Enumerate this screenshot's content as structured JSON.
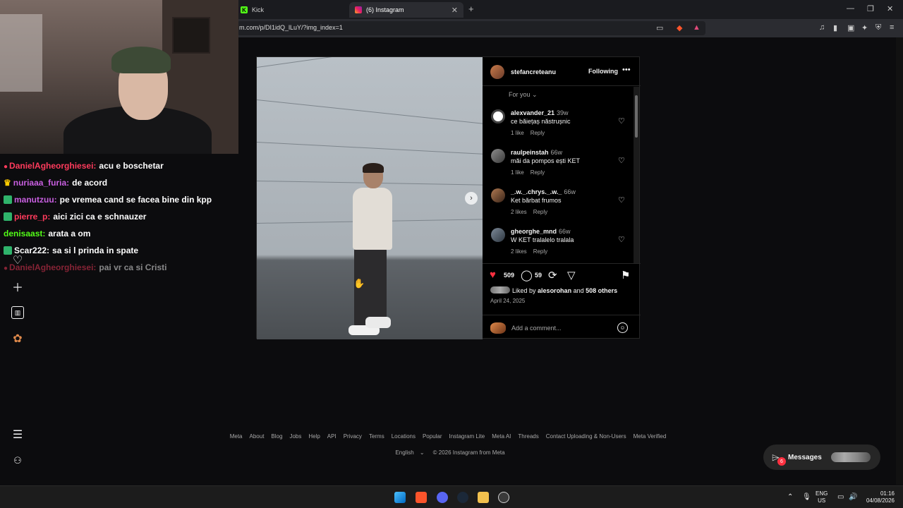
{
  "browser": {
    "tabs": [
      {
        "label": "Kick",
        "icon": "kick-icon"
      },
      {
        "label": "(6) Instagram",
        "icon": "instagram-icon"
      }
    ],
    "url": "m.com/p/DI1idQ_lLuY/?img_index=1"
  },
  "chat": [
    {
      "user": "DanielAgheorghiesei:",
      "msg": "acu e boschetar",
      "color": "#ff3b5c",
      "badge": "dot"
    },
    {
      "user": "nuriaaa_furia:",
      "msg": "de acord",
      "color": "#c85fe0",
      "badge": "crown"
    },
    {
      "user": "manutzuu:",
      "msg": "pe vremea cand se facea bine din kpp",
      "color": "#c85fe0",
      "badge": "sub"
    },
    {
      "user": "pierre_p:",
      "msg": "aici zici ca e schnauzer",
      "color": "#ff3b5c",
      "badge": "sub"
    },
    {
      "user": "denisaast:",
      "msg": "arata a om",
      "color": "#53fc18",
      "badge": "none"
    },
    {
      "user": "Scar222:",
      "msg": "sa si l prinda in spate",
      "color": "#ffffff",
      "badge": "sub"
    },
    {
      "user": "DanielAgheorghiesei:",
      "msg": "pai vr ca si Cristi",
      "color": "#ff3b5c",
      "badge": "dot",
      "faded": true
    }
  ],
  "post": {
    "username": "stefancreteanu",
    "following_label": "Following",
    "for_you": "For you",
    "comments": [
      {
        "user": "alexvander_21",
        "time": "39w",
        "text": "ce băiețaș năstrușnic",
        "likes": "1 like",
        "reply": "Reply"
      },
      {
        "user": "raulpeinstah",
        "time": "66w",
        "text": "măi da pompos ești KET",
        "likes": "1 like",
        "reply": "Reply"
      },
      {
        "user": "_.w._.chrys._.w._",
        "time": "66w",
        "text": "Ket bărbat frumos",
        "likes": "2 likes",
        "reply": "Reply"
      },
      {
        "user": "gheorghe_mnd",
        "time": "66w",
        "text": "W KET tralalelo tralala",
        "likes": "2 likes",
        "reply": "Reply"
      }
    ],
    "like_count": "509",
    "comment_count": "59",
    "liked_by_prefix": "Liked by",
    "liked_by_user": "alesorohan",
    "liked_by_and": "and",
    "liked_by_others": "508 others",
    "date": "April 24, 2025",
    "add_comment_placeholder": "Add a comment..."
  },
  "footer": {
    "links": [
      "Meta",
      "About",
      "Blog",
      "Jobs",
      "Help",
      "API",
      "Privacy",
      "Terms",
      "Locations",
      "Popular",
      "Instagram Lite",
      "Meta AI",
      "Threads",
      "Contact Uploading & Non-Users",
      "Meta Verified"
    ],
    "language": "English",
    "copyright": "© 2026 Instagram from Meta"
  },
  "messages": {
    "label": "Messages",
    "badge": "6"
  },
  "taskbar": {
    "lang_top": "ENG",
    "lang_bottom": "US",
    "time": "01:16",
    "date": "04/08/2026"
  },
  "colors": {
    "accent_like": "#ff3040",
    "kick_green": "#53fc18",
    "background": "#0c0c0e"
  }
}
